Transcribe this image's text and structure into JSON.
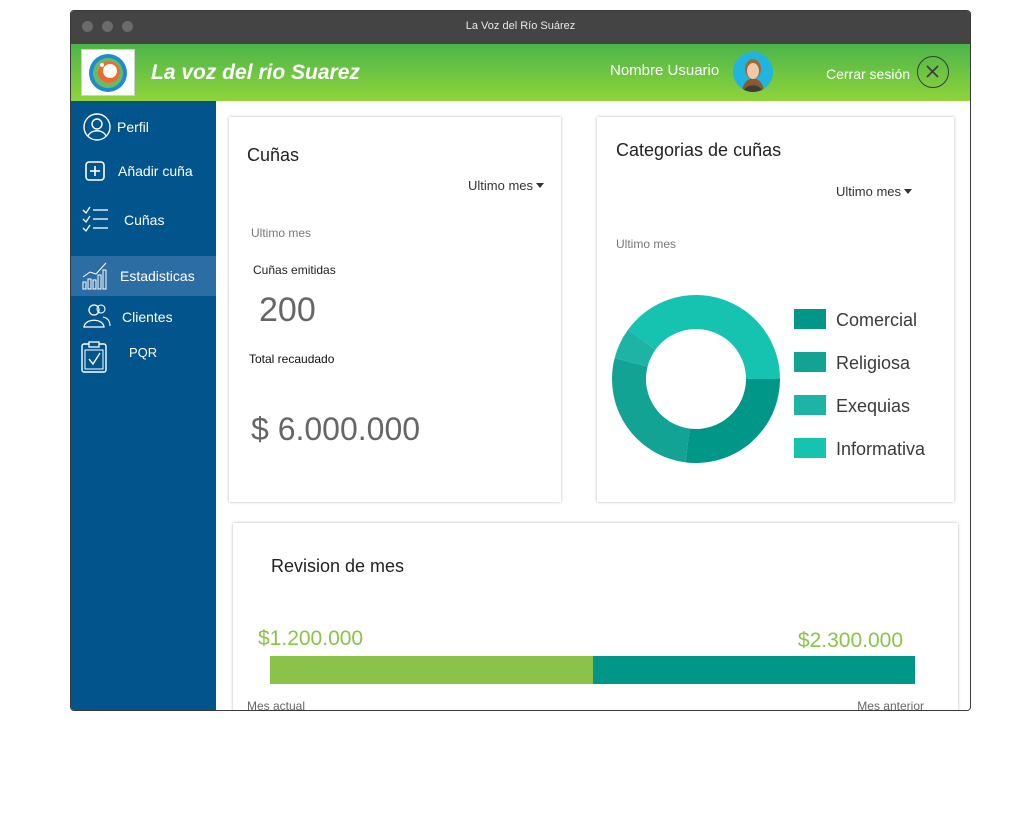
{
  "window": {
    "title": "La Voz del Río Suárez"
  },
  "header": {
    "brand": "La voz del rio Suarez",
    "username": "Nombre Usuario",
    "logout_label": "Cerrar sesión"
  },
  "sidebar": {
    "items": [
      {
        "label": "Perfil",
        "icon": "user-icon"
      },
      {
        "label": "Añadir cuña",
        "icon": "plus-square-icon"
      },
      {
        "label": "Cuñas",
        "icon": "checklist-icon"
      },
      {
        "label": "Estadisticas",
        "icon": "bar-chart-icon",
        "active": true
      },
      {
        "label": "Clientes",
        "icon": "users-icon"
      },
      {
        "label": "PQR",
        "icon": "clipboard-check-icon"
      }
    ]
  },
  "cunas_card": {
    "title": "Cuñas",
    "filter": "Ultimo mes",
    "period": "Ultimo mes",
    "emitted_label": "Cuñas emitidas",
    "emitted_value": "200",
    "total_label": "Total recaudado",
    "total_value": "$ 6.000.000"
  },
  "categorias_card": {
    "title": "Categorias de cuñas",
    "filter": "Ultimo mes",
    "period": "Ultimo mes"
  },
  "chart_data": {
    "type": "pie",
    "donut": true,
    "categories": [
      "Comercial",
      "Religiosa",
      "Exequias",
      "Informativa"
    ],
    "values": [
      27,
      27,
      6,
      40
    ],
    "colors": [
      "#009688",
      "#13a394",
      "#1db4a6",
      "#16c2b0"
    ]
  },
  "revision_card": {
    "title": "Revision de mes",
    "current_value": "$1.200.000",
    "previous_value": "$2.300.000",
    "current_label": "Mes actual",
    "previous_label": "Mes anterior",
    "current_share": 0.5,
    "colors": {
      "current": "#8bc34a",
      "previous": "#009688"
    }
  },
  "colors": {
    "sidebar": "#01548c",
    "sidebar_active": "#2c6da3",
    "accent_green": "#8bc34a",
    "accent_teal": "#009688"
  }
}
